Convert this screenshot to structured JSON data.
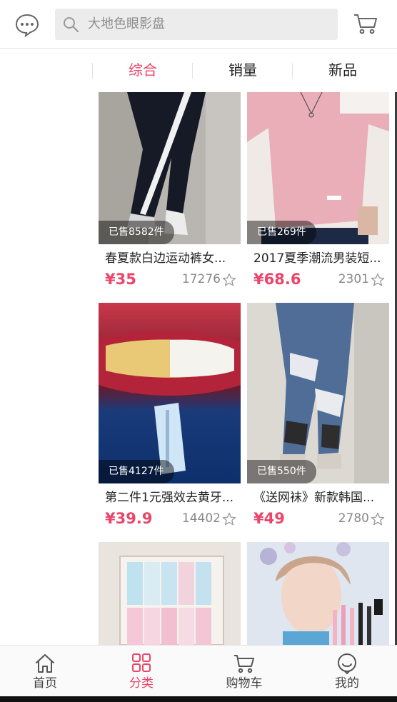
{
  "header": {
    "message_icon": "message-icon",
    "search_placeholder": "大地色眼影盘",
    "cart_icon": "cart-icon"
  },
  "sort_tabs": [
    {
      "label": "综合",
      "active": true
    },
    {
      "label": "销量",
      "active": false
    },
    {
      "label": "新品",
      "active": false
    }
  ],
  "products": [
    {
      "title": "春夏款白边运动裤女...",
      "price": "¥35",
      "sold": "已售8582件",
      "likes": "17276"
    },
    {
      "title": "2017夏季潮流男装短...",
      "price": "¥68.6",
      "sold": "已售269件",
      "likes": "2301"
    },
    {
      "title": "第二件1元强效去黄牙...",
      "price": "¥39.9",
      "sold": "已售4127件",
      "likes": "14402"
    },
    {
      "title": "《送网袜》新款韩国...",
      "price": "¥49",
      "sold": "已售550件",
      "likes": "2780"
    }
  ],
  "bottom_nav": [
    {
      "label": "首页",
      "icon": "home-icon",
      "active": false
    },
    {
      "label": "分类",
      "icon": "category-icon",
      "active": true
    },
    {
      "label": "购物车",
      "icon": "cart-icon",
      "active": false
    },
    {
      "label": "我的",
      "icon": "profile-icon",
      "active": false
    }
  ],
  "colors": {
    "accent": "#e9466a",
    "price": "#e9466a",
    "search_bg": "#ececec"
  }
}
